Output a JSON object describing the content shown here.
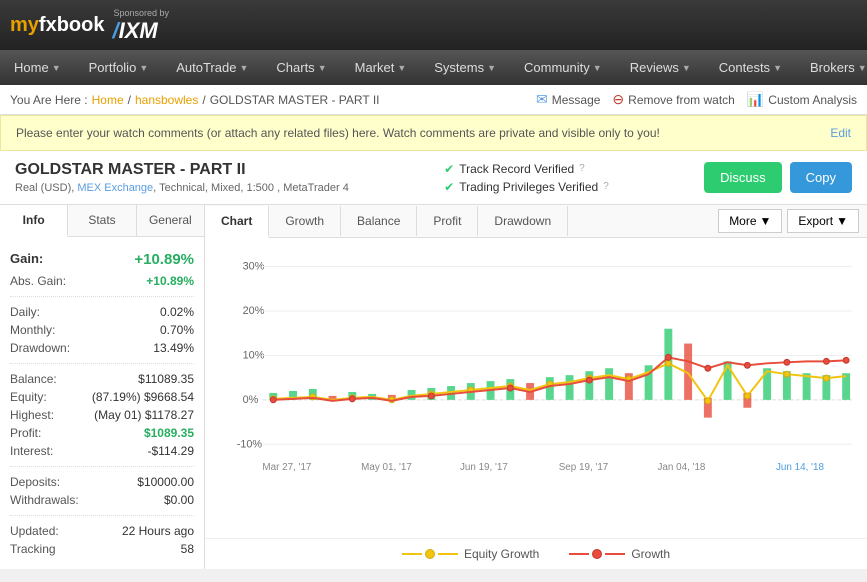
{
  "header": {
    "logo": "myfxbook",
    "sponsored_by": "Sponsored by",
    "ixm": "IXM"
  },
  "nav": {
    "items": [
      {
        "label": "Home",
        "id": "home"
      },
      {
        "label": "Portfolio",
        "id": "portfolio"
      },
      {
        "label": "AutoTrade",
        "id": "autotrade"
      },
      {
        "label": "Charts",
        "id": "charts"
      },
      {
        "label": "Market",
        "id": "market"
      },
      {
        "label": "Systems",
        "id": "systems"
      },
      {
        "label": "Community",
        "id": "community"
      },
      {
        "label": "Reviews",
        "id": "reviews"
      },
      {
        "label": "Contests",
        "id": "contests"
      },
      {
        "label": "Brokers",
        "id": "brokers"
      }
    ]
  },
  "breadcrumb": {
    "prefix": "You Are Here :",
    "home": "Home",
    "user": "hansbowles",
    "account": "GOLDSTAR MASTER - PART II",
    "actions": {
      "message": "Message",
      "remove_watch": "Remove from watch",
      "custom_analysis": "Custom Analysis"
    }
  },
  "watch_comment": {
    "text": "Please enter your watch comments (or attach any related files) here. Watch comments are private and visible only to you!",
    "edit": "Edit"
  },
  "account": {
    "title": "GOLDSTAR MASTER - PART II",
    "subtitle": "Real (USD), MEX Exchange, Technical, Mixed, 1:500 , MetaTrader 4",
    "broker_link": "MEX Exchange",
    "badges": {
      "track_record": "Track Record Verified",
      "trading_privileges": "Trading Privileges Verified"
    },
    "buttons": {
      "discuss": "Discuss",
      "copy": "Copy"
    }
  },
  "tabs": {
    "left": [
      "Info",
      "Stats",
      "General"
    ],
    "chart": [
      "Chart",
      "Growth",
      "Balance",
      "Profit",
      "Drawdown"
    ]
  },
  "stats": {
    "gain_label": "Gain:",
    "gain_value": "+10.89%",
    "abs_gain_label": "Abs. Gain:",
    "abs_gain_value": "+10.89%",
    "daily_label": "Daily:",
    "daily_value": "0.02%",
    "monthly_label": "Monthly:",
    "monthly_value": "0.70%",
    "drawdown_label": "Drawdown:",
    "drawdown_value": "13.49%",
    "balance_label": "Balance:",
    "balance_value": "$11089.35",
    "equity_label": "Equity:",
    "equity_value": "(87.19%) $9668.54",
    "highest_label": "Highest:",
    "highest_value": "(May 01) $1178.27",
    "profit_label": "Profit:",
    "profit_value": "$1089.35",
    "interest_label": "Interest:",
    "interest_value": "-$114.29",
    "deposits_label": "Deposits:",
    "deposits_value": "$10000.00",
    "withdrawals_label": "Withdrawals:",
    "withdrawals_value": "$0.00",
    "updated_label": "Updated:",
    "updated_value": "22 Hours ago",
    "tracking_label": "Tracking",
    "tracking_value": "58"
  },
  "chart": {
    "more_label": "More",
    "export_label": "Export",
    "legend": {
      "equity": "Equity Growth",
      "growth": "Growth"
    },
    "x_labels": [
      "Mar 27, '17",
      "May 01, '17",
      "Jun 19, '17",
      "Sep 19, '17",
      "Jan 04, '18",
      "Jun 14, '18"
    ],
    "y_labels": [
      "30%",
      "20%",
      "10%",
      "0%",
      "-10%"
    ]
  }
}
